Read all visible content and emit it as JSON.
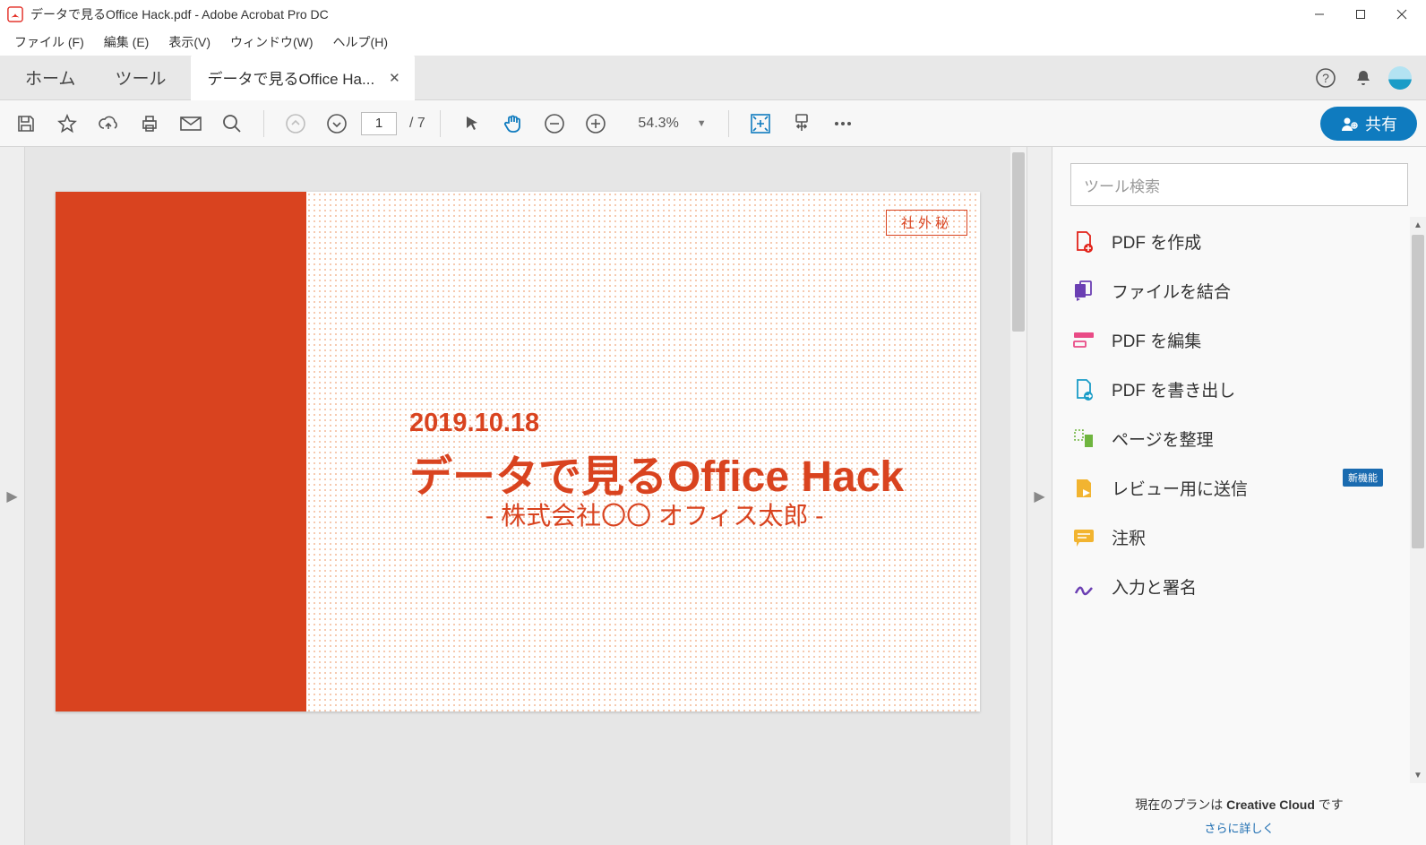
{
  "window": {
    "title": "データで見るOffice Hack.pdf - Adobe Acrobat Pro DC"
  },
  "menu": {
    "file": "ファイル (F)",
    "edit": "編集 (E)",
    "view": "表示(V)",
    "window": "ウィンドウ(W)",
    "help": "ヘルプ(H)"
  },
  "tabs": {
    "home": "ホーム",
    "tools": "ツール",
    "doc": "データで見るOffice Ha..."
  },
  "toolbar": {
    "page_current": "1",
    "page_total": "/ 7",
    "zoom": "54.3%",
    "share": "共有"
  },
  "side": {
    "search_placeholder": "ツール検索",
    "items": {
      "create": "PDF を作成",
      "combine": "ファイルを結合",
      "edit": "PDF を編集",
      "export": "PDF を書き出し",
      "organize": "ページを整理",
      "review": "レビュー用に送信",
      "comment": "注釈",
      "fillsign": "入力と署名"
    },
    "new_badge": "新機能"
  },
  "footer": {
    "plan_prefix": "現在のプランは ",
    "plan_name": "Creative Cloud",
    "plan_suffix": " です",
    "link": "さらに詳しく"
  },
  "document": {
    "stamp": "社外秘",
    "date": "2019.10.18",
    "title": "データで見るOffice Hack",
    "subtitle": "- 株式会社〇〇 オフィス太郎 -"
  }
}
